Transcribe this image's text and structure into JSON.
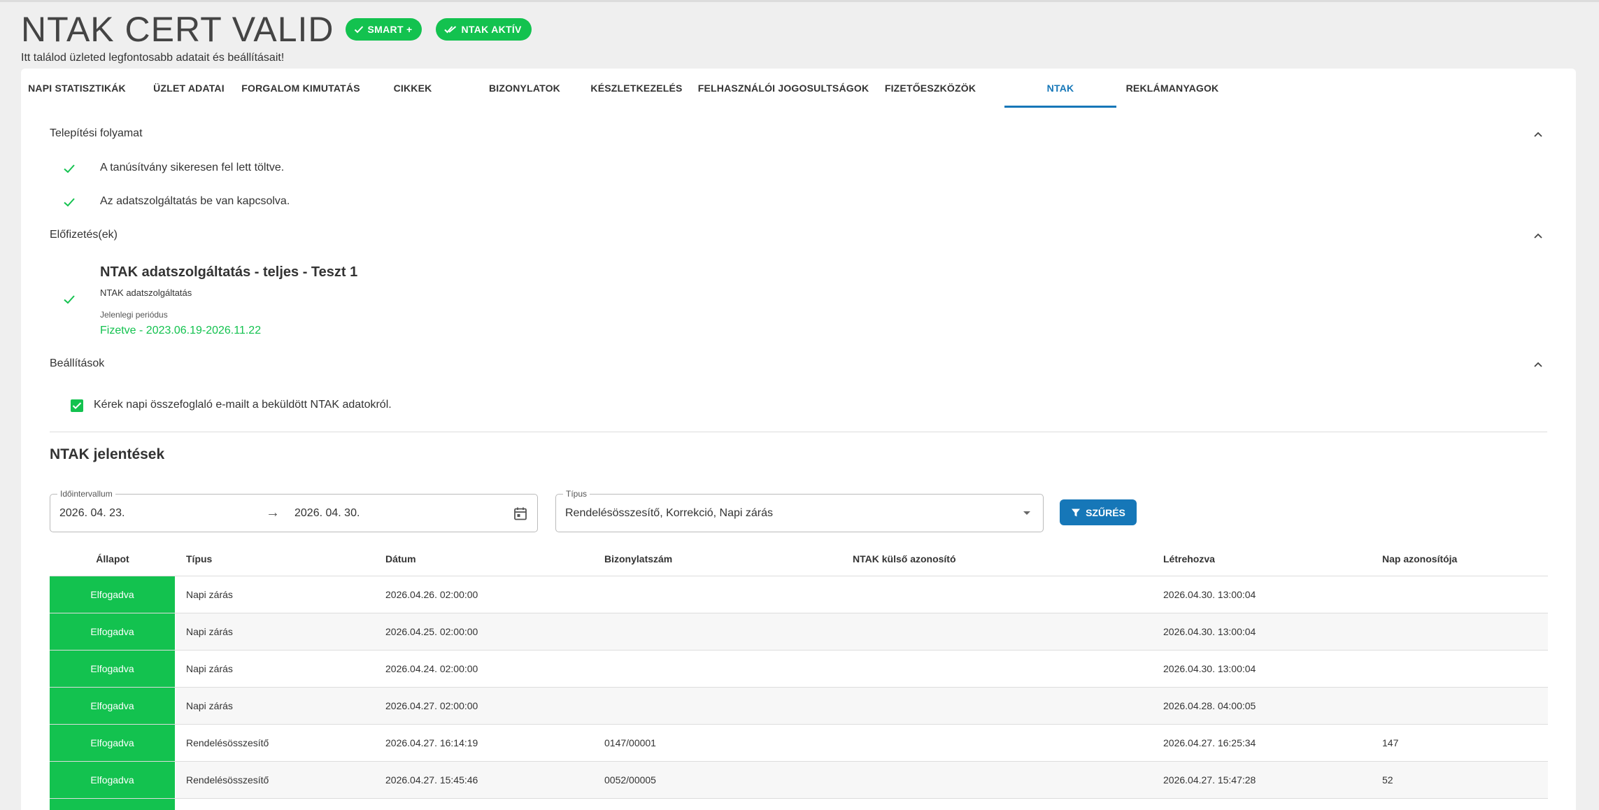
{
  "header": {
    "title": "NTAK CERT VALID",
    "badges": [
      "SMART +",
      "NTAK AKTÍV"
    ],
    "subtitle": "Itt találod üzleted legfontosabb adatait és beállításait!"
  },
  "tabs": [
    "NAPI STATISZTIKÁK",
    "ÜZLET ADATAI",
    "FORGALOM KIMUTATÁS",
    "CIKKEK",
    "BIZONYLATOK",
    "KÉSZLETKEZELÉS",
    "FELHASZNÁLÓI JOGOSULTSÁGOK",
    "FIZETŐESZKÖZÖK",
    "NTAK",
    "REKLÁMANYAGOK"
  ],
  "active_tab": "NTAK",
  "installation": {
    "title": "Telepítési folyamat",
    "items": [
      "A tanúsítvány sikeresen fel lett töltve.",
      "Az adatszolgáltatás be van kapcsolva."
    ]
  },
  "subscriptions": {
    "title": "Előfizetés(ek)",
    "name": "NTAK adatszolgáltatás - teljes - Teszt 1",
    "type": "NTAK adatszolgáltatás",
    "period_label": "Jelenlegi periódus",
    "period_value": "Fizetve - 2023.06.19-2026.11.22"
  },
  "settings": {
    "title": "Beállítások",
    "checkbox_label": "Kérek napi összefoglaló e-mailt a beküldött NTAK adatokról.",
    "checked": true
  },
  "reports": {
    "title": "NTAK jelentések",
    "interval_label": "Időintervallum",
    "date_from": "2026. 04. 23.",
    "arrow": "→",
    "date_to": "2026. 04. 30.",
    "type_label": "Típus",
    "type_value": "Rendelésösszesítő, Korrekció, Napi zárás",
    "filter_button": "SZŰRÉS",
    "columns": [
      "Állapot",
      "Típus",
      "Dátum",
      "Bizonylatszám",
      "NTAK külső azonosító",
      "Létrehozva",
      "Nap azonosítója"
    ],
    "rows": [
      {
        "status": "Elfogadva",
        "type": "Napi zárás",
        "date": "2026.04.26. 02:00:00",
        "receipt": "",
        "ext_id": "",
        "created": "2026.04.30. 13:00:04",
        "day_id": ""
      },
      {
        "status": "Elfogadva",
        "type": "Napi zárás",
        "date": "2026.04.25. 02:00:00",
        "receipt": "",
        "ext_id": "",
        "created": "2026.04.30. 13:00:04",
        "day_id": ""
      },
      {
        "status": "Elfogadva",
        "type": "Napi zárás",
        "date": "2026.04.24. 02:00:00",
        "receipt": "",
        "ext_id": "",
        "created": "2026.04.30. 13:00:04",
        "day_id": ""
      },
      {
        "status": "Elfogadva",
        "type": "Napi zárás",
        "date": "2026.04.27. 02:00:00",
        "receipt": "",
        "ext_id": "",
        "created": "2026.04.28. 04:00:05",
        "day_id": ""
      },
      {
        "status": "Elfogadva",
        "type": "Rendelésösszesítő",
        "date": "2026.04.27. 16:14:19",
        "receipt": "0147/00001",
        "ext_id": "",
        "created": "2026.04.27. 16:25:34",
        "day_id": "147"
      },
      {
        "status": "Elfogadva",
        "type": "Rendelésösszesítő",
        "date": "2026.04.27. 15:45:46",
        "receipt": "0052/00005",
        "ext_id": "",
        "created": "2026.04.27. 15:47:28",
        "day_id": "52"
      },
      {
        "status": "",
        "type": "",
        "date": "",
        "receipt": "",
        "ext_id": "",
        "created": "",
        "day_id": ""
      }
    ]
  },
  "colors": {
    "accent": "#1677b8",
    "success": "#13c24f"
  },
  "icons": [
    "check-icon",
    "double-check-icon",
    "chevron-up-icon",
    "calendar-icon",
    "filter-icon",
    "dropdown-caret-icon"
  ]
}
